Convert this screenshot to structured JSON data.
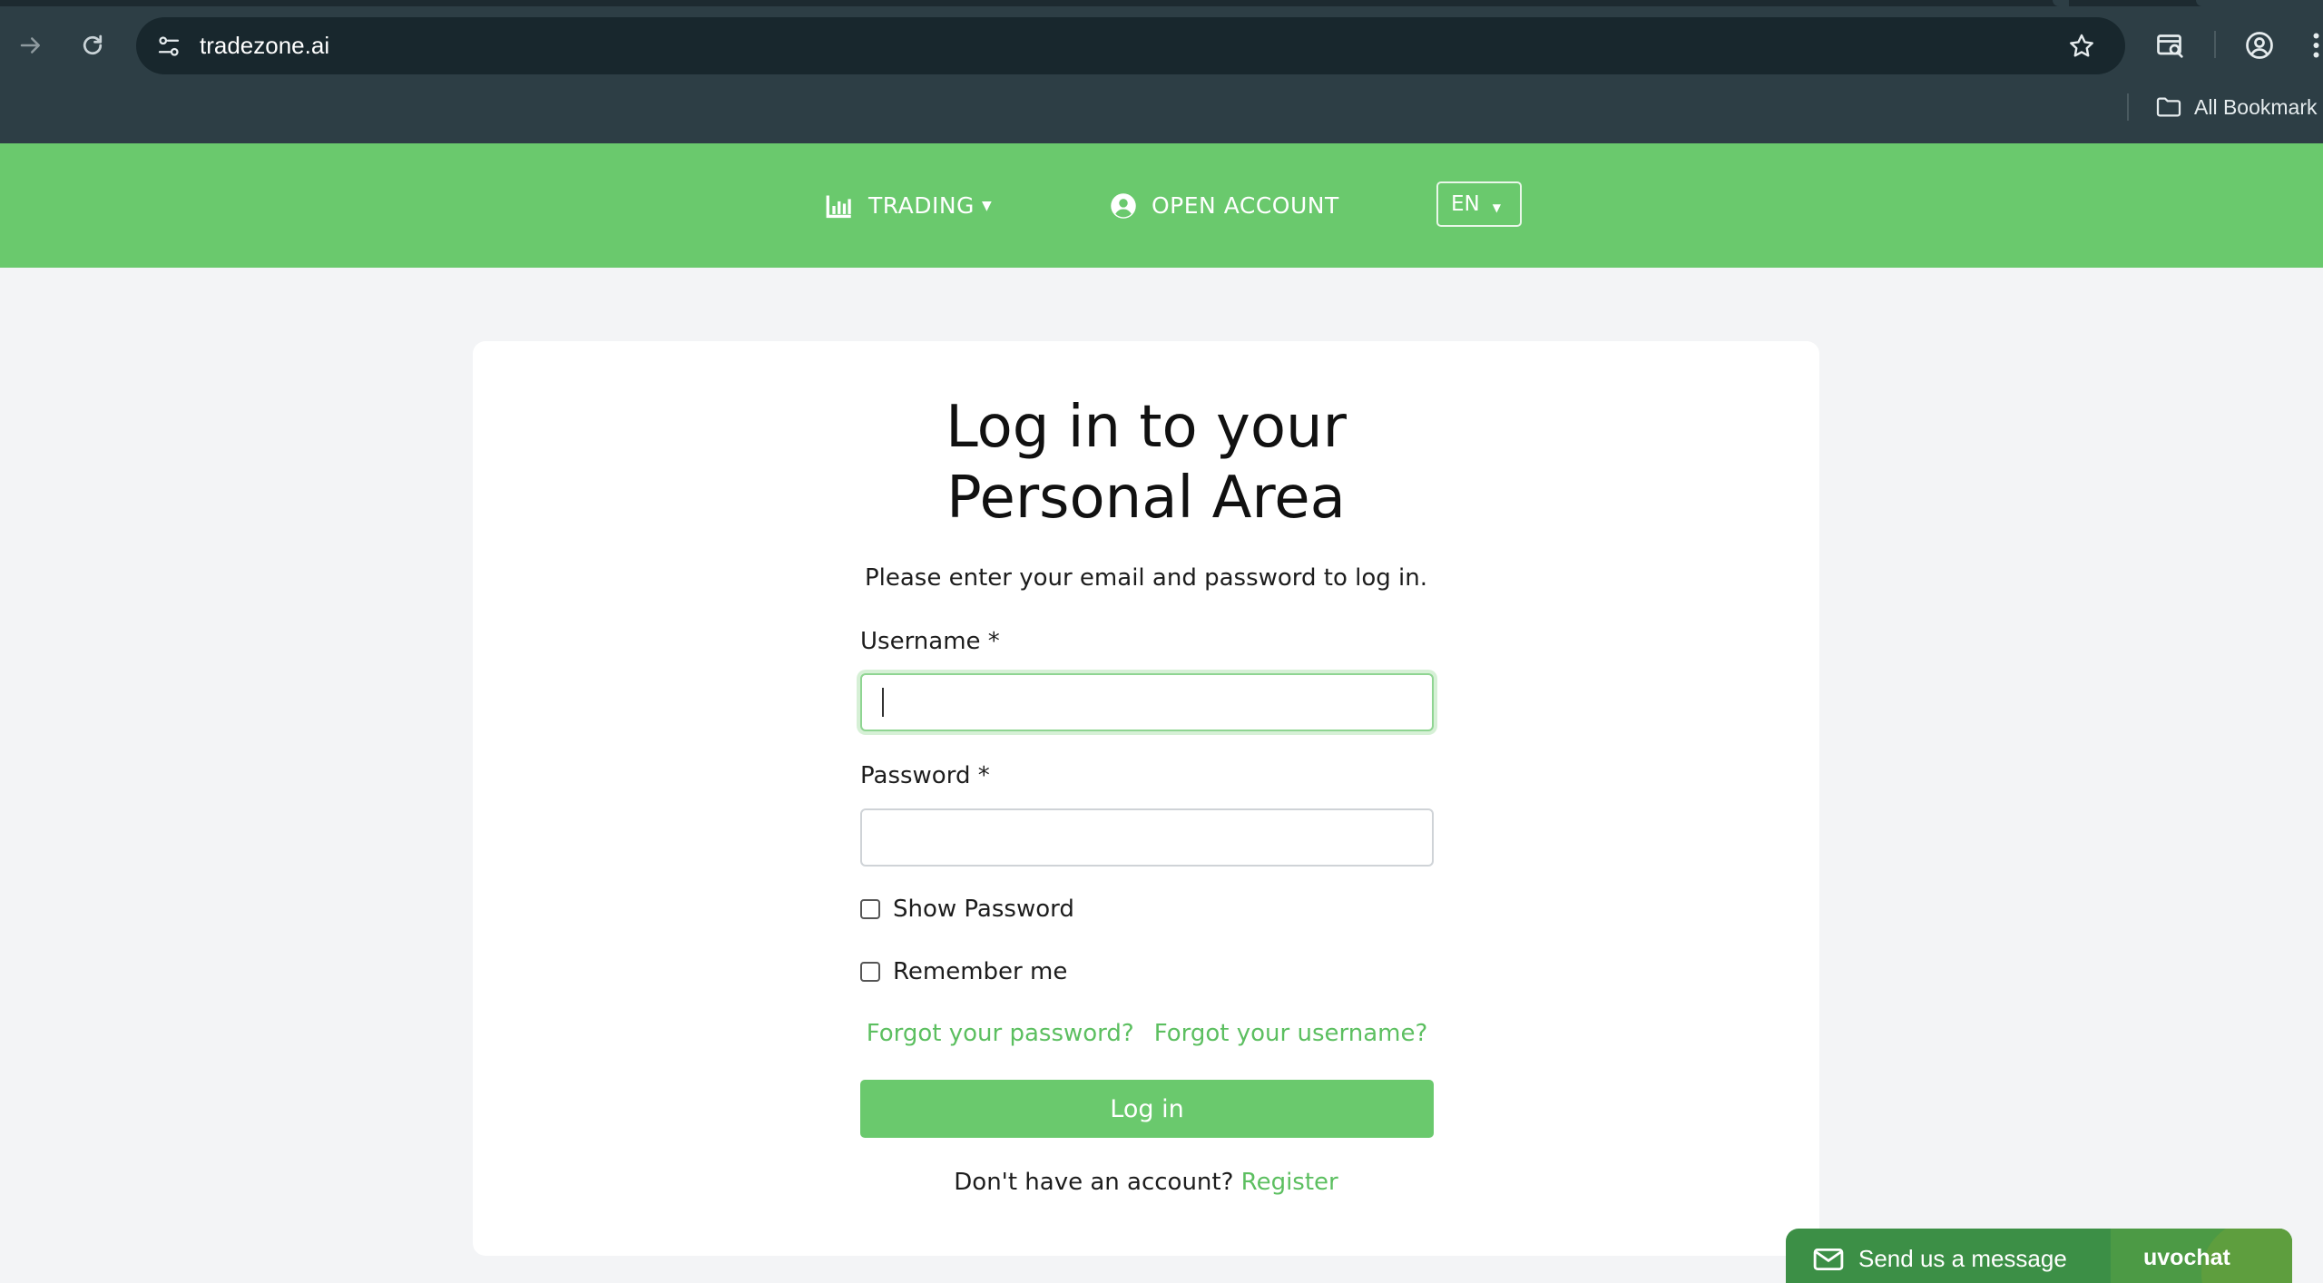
{
  "browser": {
    "url": "tradezone.ai",
    "bookmarks_label": "All Bookmark"
  },
  "header": {
    "nav": [
      {
        "label": "TRADING",
        "icon": "bar-chart-icon",
        "has_dropdown": true
      },
      {
        "label": "OPEN ACCOUNT",
        "icon": "user-circle-icon"
      }
    ],
    "language": "EN"
  },
  "login": {
    "title_line1": "Log in to your",
    "title_line2": "Personal Area",
    "subtitle": "Please enter your email and password to log in.",
    "username_label": "Username *",
    "username_value": "",
    "password_label": "Password *",
    "password_value": "",
    "show_password_label": "Show Password",
    "show_password_checked": false,
    "remember_me_label": "Remember me",
    "remember_me_checked": false,
    "forgot_password": "Forgot your password?",
    "forgot_username": "Forgot your username?",
    "login_button": "Log in",
    "no_account_text": "Don't have an account?",
    "register_link": "Register"
  },
  "chat": {
    "message_label": "Send us a message",
    "brand": "uvochat"
  },
  "colors": {
    "brand_green": "#6ac96d",
    "link_green": "#5cbf60",
    "chrome_bg": "#2d3e45",
    "page_bg": "#f3f4f6"
  }
}
